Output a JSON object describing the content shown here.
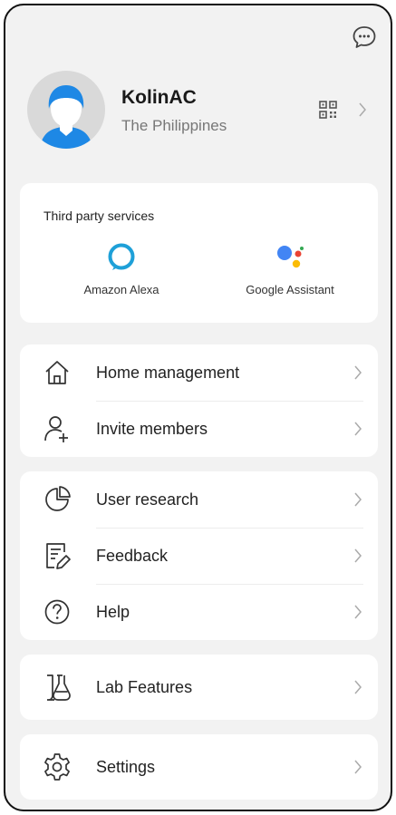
{
  "profile": {
    "name": "KolinAC",
    "location": "The Philippines"
  },
  "services": {
    "title": "Third party services",
    "items": [
      {
        "label": "Amazon Alexa",
        "icon": "alexa-icon"
      },
      {
        "label": "Google Assistant",
        "icon": "google-assistant-icon"
      }
    ]
  },
  "menu": {
    "home_management": "Home management",
    "invite_members": "Invite members",
    "user_research": "User research",
    "feedback": "Feedback",
    "help": "Help",
    "lab_features": "Lab Features",
    "settings": "Settings"
  },
  "colors": {
    "background": "#f2f2f2",
    "card": "#ffffff",
    "avatar_blue": "#1e88e5",
    "alexa": "#1ea0d8",
    "google_blue": "#4285f4",
    "google_red": "#ea4335",
    "google_yellow": "#fbbc05",
    "google_green": "#34a853"
  }
}
